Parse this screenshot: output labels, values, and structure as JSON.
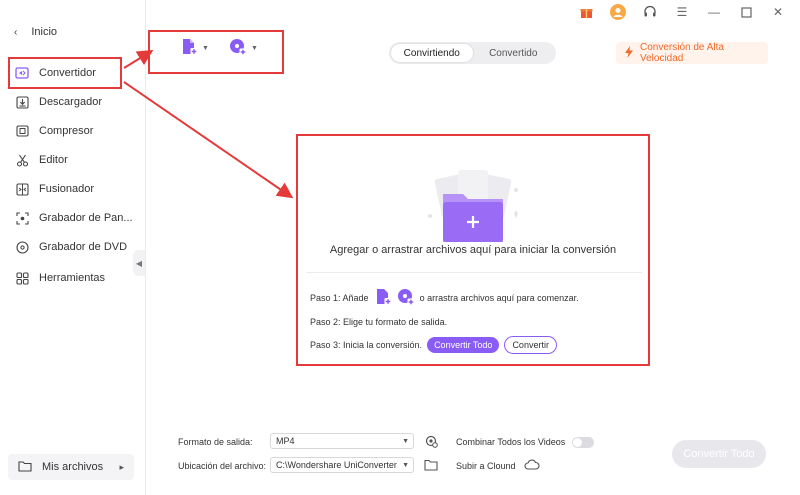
{
  "sidebar": {
    "back_label": "Inicio",
    "items": [
      {
        "label": "Convertidor",
        "icon": "converter-icon"
      },
      {
        "label": "Descargador",
        "icon": "download-icon"
      },
      {
        "label": "Compresor",
        "icon": "compress-icon"
      },
      {
        "label": "Editor",
        "icon": "scissors-icon"
      },
      {
        "label": "Fusionador",
        "icon": "merge-icon"
      },
      {
        "label": "Grabador de Pan...",
        "icon": "screen-record-icon"
      },
      {
        "label": "Grabador de DVD",
        "icon": "dvd-icon"
      },
      {
        "label": "Herramientas",
        "icon": "grid-icon"
      }
    ],
    "files_label": "Mis archivos"
  },
  "header": {
    "tabs": [
      {
        "label": "Convirtiendo",
        "active": true
      },
      {
        "label": "Convertido",
        "active": false
      }
    ],
    "speed_label": "Conversión de Alta Velocidad"
  },
  "dropzone": {
    "main_text": "Agregar o arrastrar archivos aquí para iniciar la conversión",
    "step1_prefix": "Paso 1: Añade",
    "step1_suffix": "o arrastra archivos aquí para comenzar.",
    "step2": "Paso 2: Elige tu formato de salida.",
    "step3": "Paso 3: Inicia la conversión.",
    "convert_all_label": "Convertir Todo",
    "convert_label": "Convertir"
  },
  "bottom": {
    "format_label": "Formato de salida:",
    "format_value": "MP4",
    "location_label": "Ubicación del archivo:",
    "location_value": "C:\\Wondershare UniConverter",
    "merge_label": "Combinar Todos los Videos",
    "cloud_label": "Subir a Clound",
    "convert_all_label": "Convertir Todo"
  },
  "colors": {
    "accent": "#8a5cf6",
    "highlight": "#e43a3a",
    "speed": "#f06a2a"
  }
}
